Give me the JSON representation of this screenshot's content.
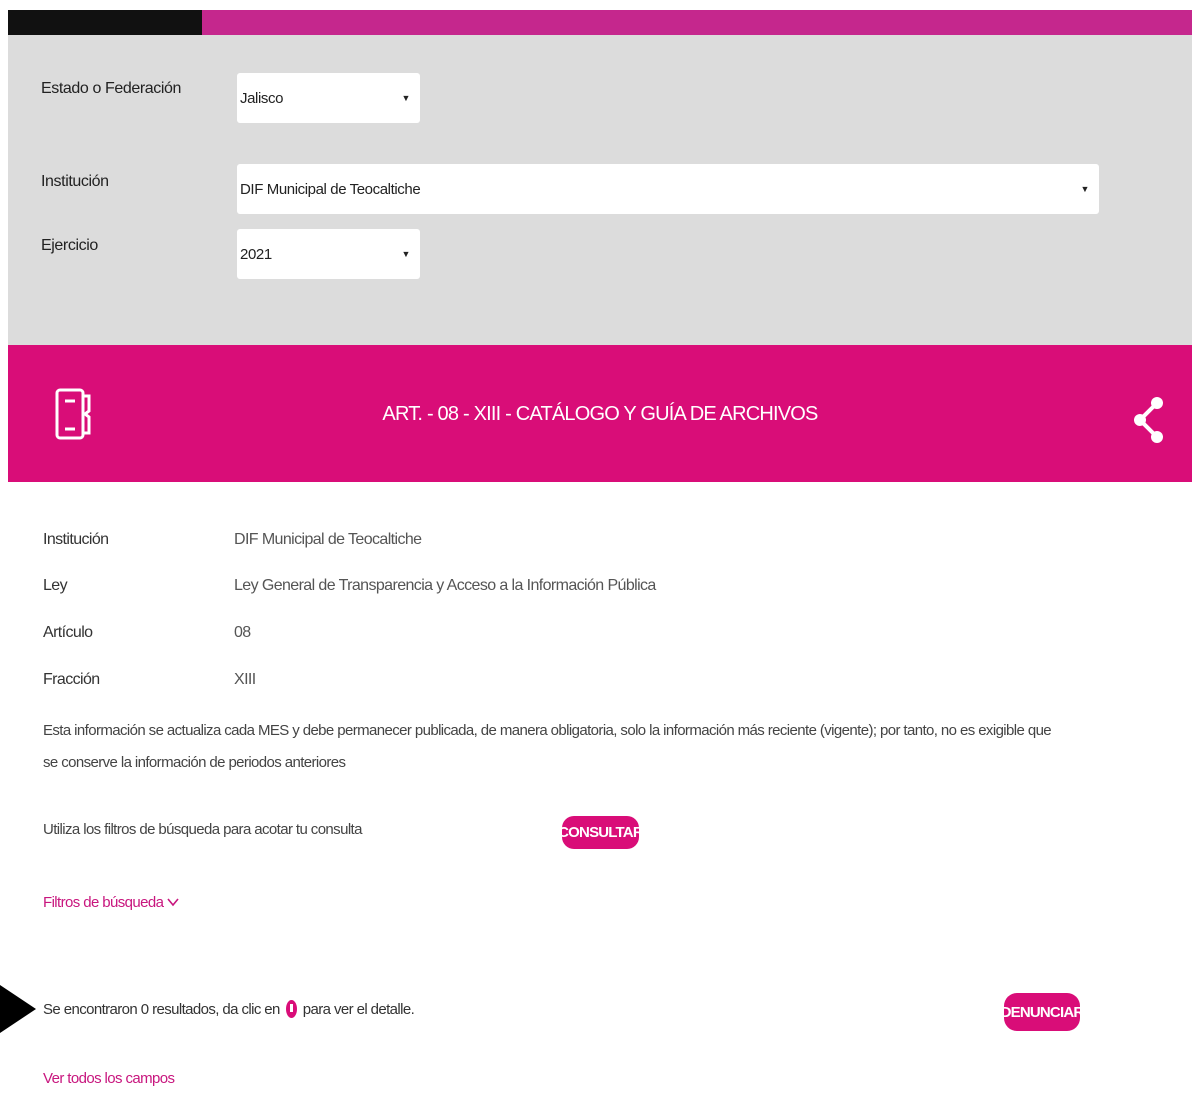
{
  "filters": {
    "estado": {
      "label": "Estado o Federación",
      "value": "Jalisco"
    },
    "institucion": {
      "label": "Institución",
      "value": "DIF Municipal de Teocaltiche"
    },
    "ejercicio": {
      "label": "Ejercicio",
      "value": "2021"
    }
  },
  "banner": {
    "title": "ART. - 08 - XIII - CATÁLOGO Y GUÍA DE ARCHIVOS",
    "doc_icon": "document-icon",
    "share_icon": "share-icon"
  },
  "details": {
    "institucion": {
      "label": "Institución",
      "value": "DIF Municipal de Teocaltiche"
    },
    "ley": {
      "label": "Ley",
      "value": "Ley General de Transparencia y Acceso a la Información Pública"
    },
    "articulo": {
      "label": "Artículo",
      "value": "08"
    },
    "fraccion": {
      "label": "Fracción",
      "value": "XIII"
    }
  },
  "notice": "Esta información se actualiza cada MES y debe permanecer publicada, de manera obligatoria, solo la información más reciente (vigente); por tanto, no es exigible que se conserve la información de periodos anteriores",
  "hint": "Utiliza los filtros de búsqueda para acotar tu consulta",
  "consultar_label": "CONSULTAR",
  "filtros_link": "Filtros de búsqueda",
  "results": {
    "prefix": "Se encontraron",
    "count": "0",
    "middle": "resultados, da clic en",
    "suffix": "para ver el detalle."
  },
  "denunciar_label": "DENUNCIAR",
  "ver_todos_link": "Ver todos los campos",
  "colors": {
    "magenta": "#d90d78",
    "strip": "#c5278d",
    "panel": "#dcdcdc"
  }
}
